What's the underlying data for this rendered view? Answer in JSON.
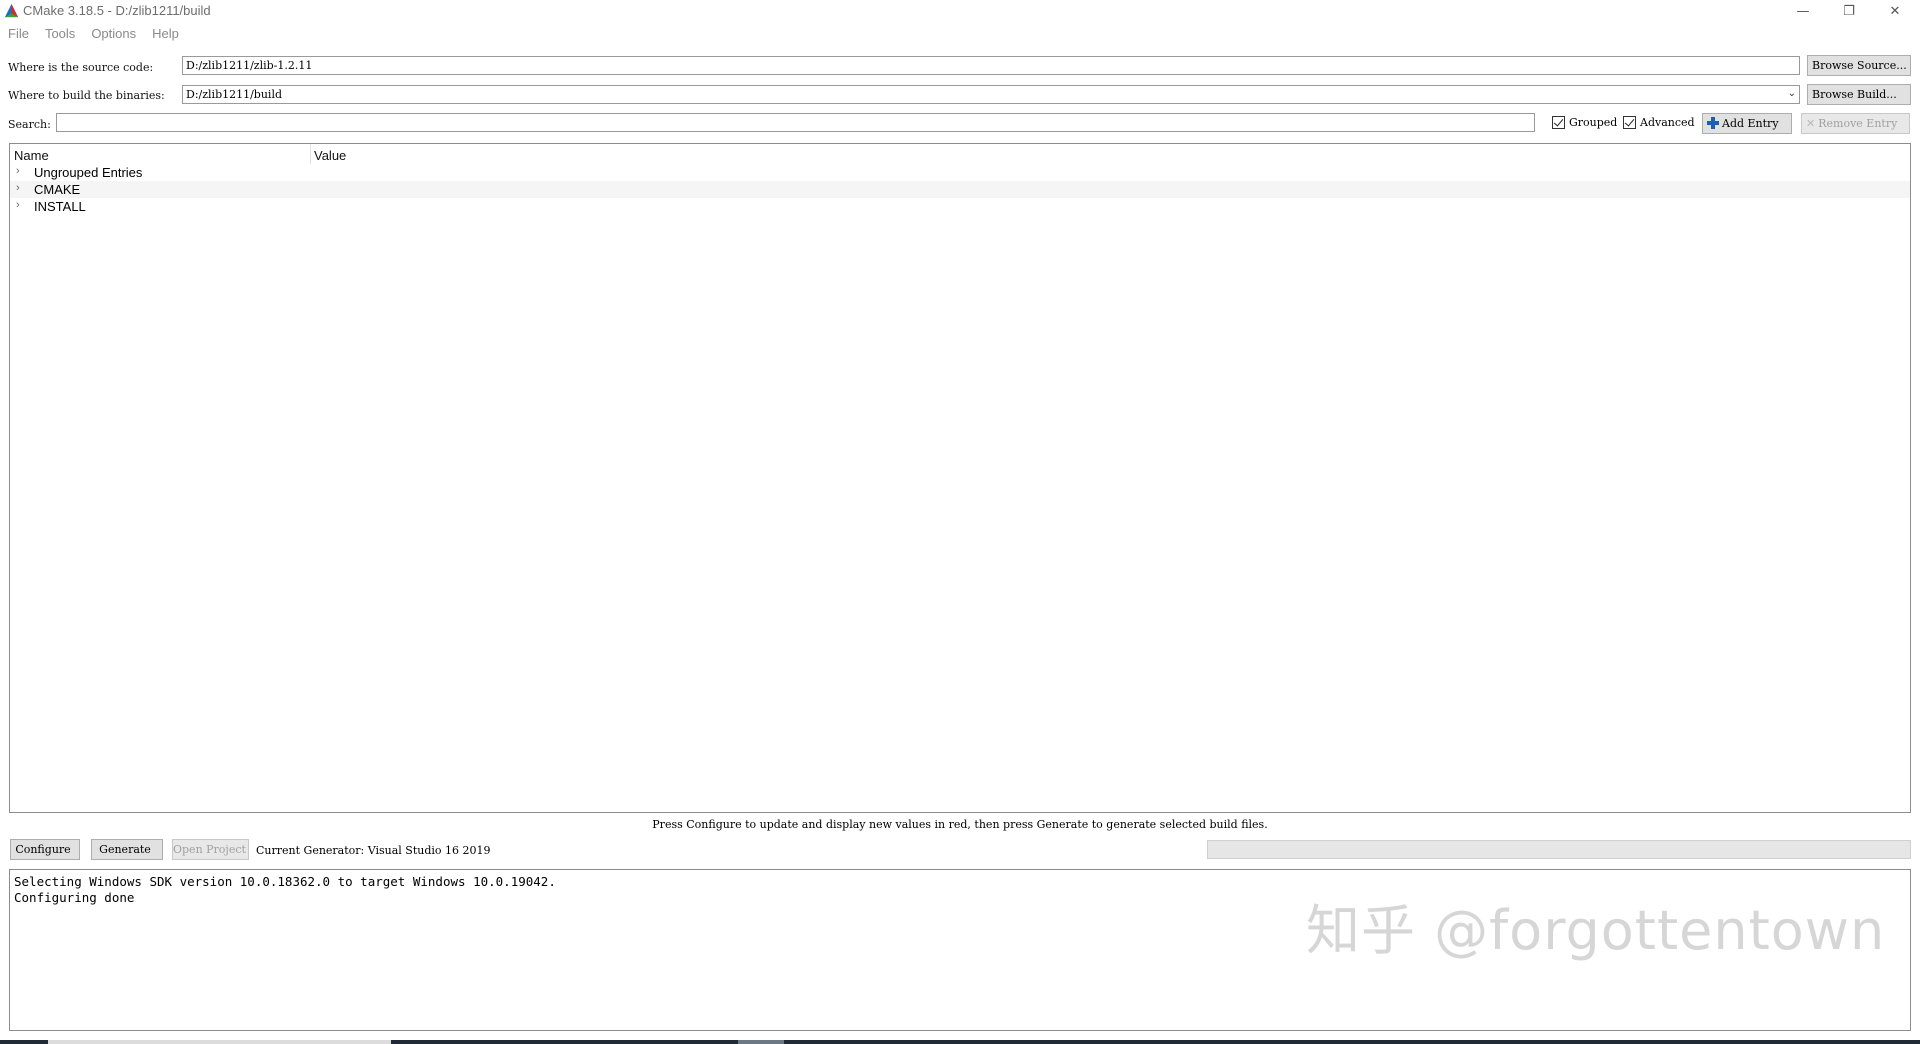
{
  "window": {
    "title": "CMake 3.18.5 - D:/zlib1211/build",
    "controls": {
      "minimize": "—",
      "restore": "❐",
      "close": "✕"
    }
  },
  "menu": [
    "File",
    "Tools",
    "Options",
    "Help"
  ],
  "source": {
    "label": "Where is the source code:",
    "value": "D:/zlib1211/zlib-1.2.11",
    "browse": "Browse Source..."
  },
  "build": {
    "label": "Where to build the binaries:",
    "value": "D:/zlib1211/build",
    "browse": "Browse Build..."
  },
  "search": {
    "label": "Search:",
    "value": ""
  },
  "options": {
    "grouped": "Grouped",
    "grouped_checked": true,
    "advanced": "Advanced",
    "advanced_checked": true,
    "add_entry": "Add Entry",
    "remove_entry": "Remove Entry"
  },
  "tree": {
    "columns": [
      "Name",
      "Value"
    ],
    "rows": [
      "Ungrouped Entries",
      "CMAKE",
      "INSTALL"
    ]
  },
  "status_message": "Press Configure to update and display new values in red, then press Generate to generate selected build files.",
  "actions": {
    "configure": "Configure",
    "generate": "Generate",
    "open_project": "Open Project",
    "generator": "Current Generator: Visual Studio 16 2019"
  },
  "output": {
    "lines": [
      "Selecting Windows SDK version 10.0.18362.0 to target Windows 10.0.19042.",
      "Configuring done"
    ]
  },
  "watermark": "知乎 @forgottentown",
  "colors": {
    "accent": "#1c5fb5",
    "disabled_text": "#a0a0a0",
    "button_bg": "#e1e1e1"
  }
}
